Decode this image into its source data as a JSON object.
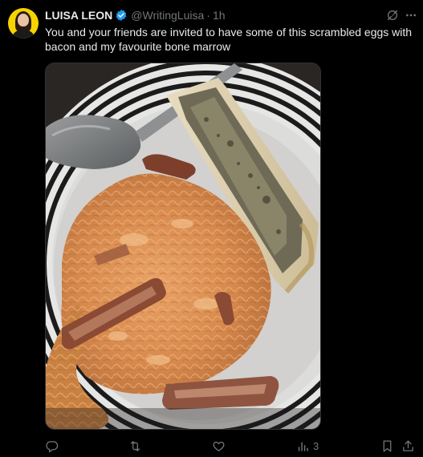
{
  "author": {
    "name": "LUISA LEON",
    "handle": "@WritingLuisa",
    "separator": "·",
    "time": "1h"
  },
  "post": {
    "text": "You and your friends are invited to have some of this scrambled eggs with bacon and my favourite bone marrow"
  },
  "icons": {
    "verified": "verified-badge-icon",
    "grok": "grok-icon",
    "more": "more-icon",
    "reply": "reply-icon",
    "repost": "repost-icon",
    "like": "like-icon",
    "views": "views-icon",
    "bookmark": "bookmark-icon",
    "share": "share-icon"
  },
  "stats": {
    "views": "3"
  },
  "colors": {
    "background": "#000000",
    "text": "#e7e9ea",
    "muted": "#71767b",
    "verified": "#1d9bf0",
    "avatar_bg": "#f5d400"
  }
}
